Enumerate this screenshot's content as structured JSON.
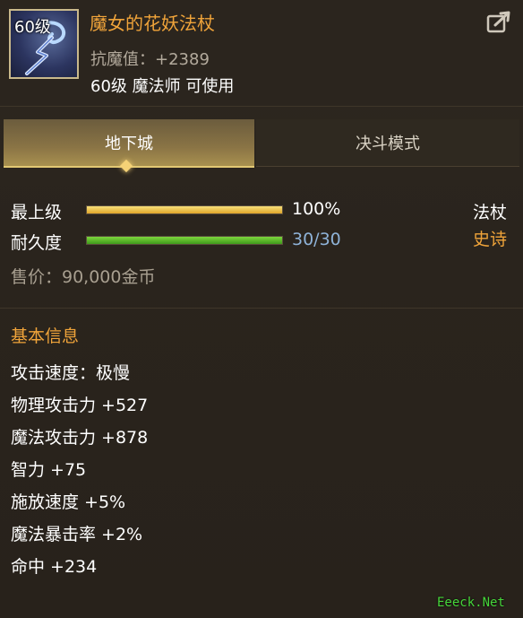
{
  "item": {
    "level_badge": "60级",
    "name": "魔女的花妖法杖",
    "stat": "抗魔值：+2389",
    "requirement": "60级 魔法师 可使用",
    "icon": "staff-icon"
  },
  "tabs": [
    {
      "label": "地下城",
      "active": true
    },
    {
      "label": "决斗模式",
      "active": false
    }
  ],
  "bars": {
    "level": {
      "label": "最上级",
      "value_text": "100%",
      "fraction": 1.0,
      "color": "#f0b23a"
    },
    "durability": {
      "label": "耐久度",
      "value_text": "30/30",
      "fraction": 1.0,
      "color": "#5cc12e"
    }
  },
  "type": {
    "weapon": "法杖",
    "rarity": "史诗"
  },
  "price": "售价：90,000金币",
  "basic_info": {
    "title": "基本信息",
    "attributes": [
      "攻击速度：极慢",
      "物理攻击力 +527",
      "魔法攻击力 +878",
      "智力 +75",
      "施放速度 +5%",
      "魔法暴击率 +2%",
      "命中 +234"
    ]
  },
  "watermark": "Eeeck.Net",
  "colors": {
    "accent": "#f0a43a",
    "muted": "#b3aa9c",
    "bar_value": "#8fb3d8"
  }
}
